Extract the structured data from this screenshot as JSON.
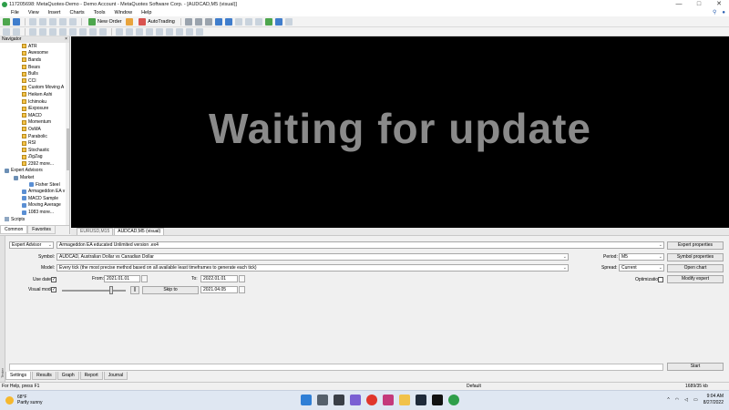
{
  "title_bar": {
    "text": "117205698: MetaQuotes-Demo - Demo Account - MetaQuotes Software Corp. - [AUDCAD,M5 (visual)]",
    "minimize": "—",
    "maximize": "□",
    "close": "✕"
  },
  "menu": [
    "File",
    "View",
    "Insert",
    "Charts",
    "Tools",
    "Window",
    "Help"
  ],
  "toolbar": {
    "new_order": "New Order",
    "autotrading": "AutoTrading"
  },
  "navigator": {
    "title": "Navigator",
    "close": "×",
    "items": [
      "ATR",
      "Awesome",
      "Bands",
      "Bears",
      "Bulls",
      "CCI",
      "Custom Moving A",
      "Heiken Ashi",
      "Ichimoku",
      "iExposure",
      "MACD",
      "Momentum",
      "OsMA",
      "Parabolic",
      "RSI",
      "Stochastic",
      "ZigZag",
      "2392 more..."
    ],
    "expert_advisors": "Expert Advisors",
    "market": "Market",
    "market_item": "Fisher Steel",
    "ea_items": [
      "Armageddon EA v",
      "MACD Sample",
      "Moving Average",
      "1083 more..."
    ],
    "scripts": "Scripts",
    "tabs": [
      "Common",
      "Favorites"
    ]
  },
  "chart": {
    "message": "Waiting for update",
    "tabs": [
      "EURUSD,M15",
      "AUDCAD,M5 (visual)"
    ]
  },
  "tester": {
    "side_label": "Tester",
    "type": "Expert Advisor",
    "expert": "Armageddon EA educated Unlimited version .ex4",
    "symbol_label": "Symbol:",
    "symbol": "AUDCAD, Australian Dollar vs Canadian Dollar",
    "model_label": "Model:",
    "model": "Every tick (the most precise method based on all available least timeframes to generate each tick)",
    "use_date_label": "Use date",
    "from_label": "From:",
    "from": "2021.01.01",
    "to_label": "To:",
    "to": "2022.01.01",
    "visual_label": "Visual mode",
    "pause": "||",
    "skip_to": "Skip to",
    "skip_date": "2021.04.05",
    "period_label": "Period:",
    "period": "M5",
    "spread_label": "Spread:",
    "spread": "Current",
    "optimization_label": "Optimization",
    "buttons": {
      "expert_properties": "Expert properties",
      "symbol_properties": "Symbol properties",
      "open_chart": "Open chart",
      "modify_expert": "Modify expert",
      "start": "Start"
    },
    "tabs": [
      "Settings",
      "Results",
      "Graph",
      "Report",
      "Journal"
    ]
  },
  "status": {
    "help": "For Help, press F1",
    "profile": "Default",
    "traffic": "1689/35 kb"
  },
  "taskbar": {
    "temp": "68°F",
    "weather": "Partly sunny",
    "time": "9:04 AM",
    "date": "8/27/2022"
  }
}
